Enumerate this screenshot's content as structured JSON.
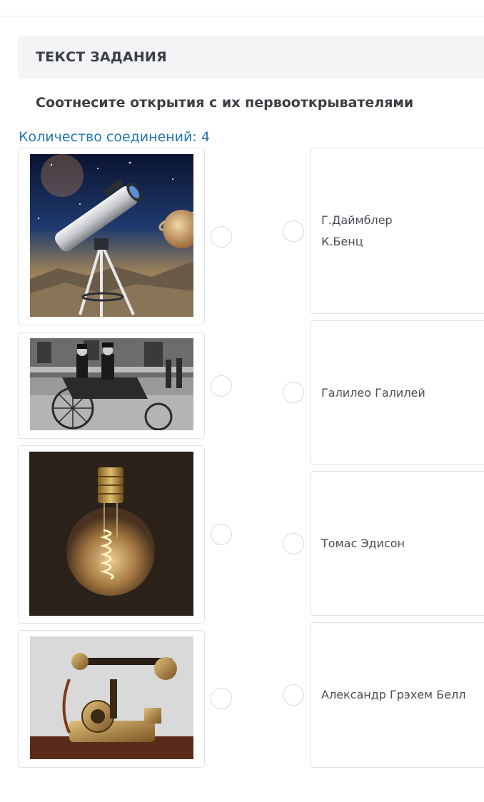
{
  "task_header": "ТЕКСТ ЗАДАНИЯ",
  "question": "Соотнесите открытия с их первооткрывателями",
  "connections_label": "Количество соединений: 4",
  "left_items": [
    {
      "image": "telescope-image"
    },
    {
      "image": "motor-carriage-image"
    },
    {
      "image": "light-bulb-image"
    },
    {
      "image": "vintage-telephone-image"
    }
  ],
  "right_items": [
    {
      "lines": [
        "Г.Даймблер",
        "К.Бенц"
      ]
    },
    {
      "lines": [
        "Галилео Галилей"
      ]
    },
    {
      "lines": [
        "Томас Эдисон"
      ]
    },
    {
      "lines": [
        "Александр Грэхем Белл"
      ]
    }
  ],
  "colors": {
    "accent": "#2577b5",
    "header_bg": "#f3f4f6",
    "border": "#dfe2e6"
  }
}
